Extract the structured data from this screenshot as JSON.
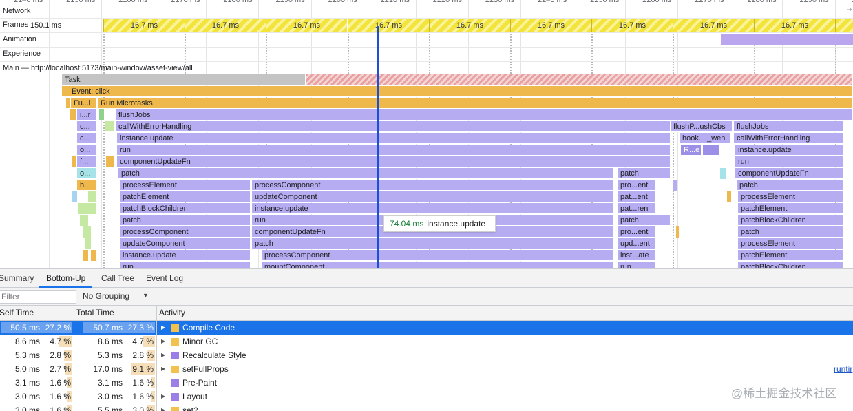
{
  "timeline": {
    "ruler_ticks": [
      "2140 ms",
      "2150 ms",
      "2160 ms",
      "2170 ms",
      "2180 ms",
      "2190 ms",
      "2200 ms",
      "2210 ms",
      "2220 ms",
      "2230 ms",
      "2240 ms",
      "2250 ms",
      "2260 ms",
      "2270 ms",
      "2280 ms",
      "2290 ms",
      "2300 ms"
    ],
    "tracks": {
      "network": "Network",
      "frames": "Frames",
      "frames_value": "150.1 ms",
      "animation": "Animation",
      "experience": "Experience",
      "main": "Main — http://localhost:5173/main-window/asset-view/all"
    },
    "frame_label": "16.7 ms",
    "flame": {
      "task": "Task",
      "event_click": "Event: click",
      "fu": "Fu...l",
      "run_microtasks": "Run Microtasks",
      "ir": "i...r",
      "c1": "c...",
      "c2": "c...",
      "o1": "o...",
      "f1": "f...",
      "o2": "o...",
      "h1": "h...",
      "flushJobs": "flushJobs",
      "callWithErrorHandling": "callWithErrorHandling",
      "instance_update": "instance.update",
      "run": "run",
      "componentUpdateFn": "componentUpdateFn",
      "patch": "patch",
      "processElement": "processElement",
      "patchElement": "patchElement",
      "patchBlockChildren": "patchBlockChildren",
      "patch2": "patch",
      "processComponent": "processComponent",
      "updateComponent": "updateComponent",
      "instance_update2": "instance.update",
      "run2": "run",
      "col2": [
        "processComponent",
        "updateComponent",
        "instance.update",
        "run",
        "componentUpdateFn",
        "patch"
      ],
      "col2b": [
        "processComponent",
        "mountComponent"
      ],
      "col3": [
        "patch",
        "pro...ent",
        "pat...ent",
        "pat...ren",
        "patch",
        "pro...ent",
        "upd...ent",
        "inst...ate",
        "run"
      ],
      "flushP": "flushP...ushCbs",
      "hook": "hook...._weh",
      "re": "R...e",
      "col5": [
        "flushJobs",
        "callWithErrorHandling",
        "instance.update",
        "run",
        "componentUpdateFn",
        "patch",
        "processElement",
        "patchElement",
        "patchBlockChildren",
        "patch",
        "processElement",
        "patchElement",
        "patchBlockChildren"
      ]
    },
    "tooltip": {
      "duration": "74.04 ms",
      "name": "instance.update"
    }
  },
  "tabs": [
    "Summary",
    "Bottom-Up",
    "Call Tree",
    "Event Log"
  ],
  "active_tab": "Bottom-Up",
  "filter": {
    "placeholder": "Filter"
  },
  "grouping": "No Grouping",
  "columns": {
    "self": "Self Time",
    "total": "Total Time",
    "activity": "Activity"
  },
  "rows": [
    {
      "self": "50.5 ms",
      "self_pct": "27.2 %",
      "self_frac": 0.272,
      "total": "50.7 ms",
      "total_pct": "27.3 %",
      "total_frac": 0.273,
      "name": "Compile Code",
      "color": "#f2c14e",
      "expand": true
    },
    {
      "self": "8.6 ms",
      "self_pct": "4.7 %",
      "self_frac": 0.047,
      "total": "8.6 ms",
      "total_pct": "4.7 %",
      "total_frac": 0.047,
      "name": "Minor GC",
      "color": "#f2c14e",
      "expand": true
    },
    {
      "self": "5.3 ms",
      "self_pct": "2.8 %",
      "self_frac": 0.028,
      "total": "5.3 ms",
      "total_pct": "2.8 %",
      "total_frac": 0.028,
      "name": "Recalculate Style",
      "color": "#9b7fe6",
      "expand": true
    },
    {
      "self": "5.0 ms",
      "self_pct": "2.7 %",
      "self_frac": 0.027,
      "total": "17.0 ms",
      "total_pct": "9.1 %",
      "total_frac": 0.091,
      "name": "setFullProps",
      "color": "#f2c14e",
      "expand": true
    },
    {
      "self": "3.1 ms",
      "self_pct": "1.6 %",
      "self_frac": 0.016,
      "total": "3.1 ms",
      "total_pct": "1.6 %",
      "total_frac": 0.016,
      "name": "Pre-Paint",
      "color": "#9b7fe6",
      "expand": false
    },
    {
      "self": "3.0 ms",
      "self_pct": "1.6 %",
      "self_frac": 0.016,
      "total": "3.0 ms",
      "total_pct": "1.6 %",
      "total_frac": 0.016,
      "name": "Layout",
      "color": "#9b7fe6",
      "expand": true
    },
    {
      "self": "3.0 ms",
      "self_pct": "1.6 %",
      "self_frac": 0.016,
      "total": "5.5 ms",
      "total_pct": "3.0 %",
      "total_frac": 0.03,
      "name": "set2",
      "color": "#f2c14e",
      "expand": true
    }
  ],
  "source_link": "runtir",
  "watermark": "@稀土掘金技术社区"
}
